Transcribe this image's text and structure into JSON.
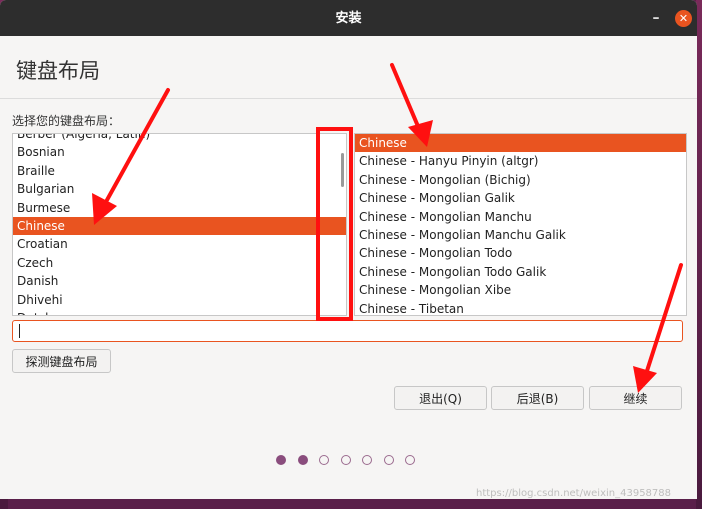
{
  "window": {
    "title": "安装",
    "minimize_glyph": "–",
    "close_glyph": "✕"
  },
  "page": {
    "title": "键盘布局",
    "prompt": "选择您的键盘布局："
  },
  "layouts_left": {
    "items": [
      "Berber (Algeria, Latin)",
      "Bosnian",
      "Braille",
      "Bulgarian",
      "Burmese",
      "Chinese",
      "Croatian",
      "Czech",
      "Danish",
      "Dhivehi",
      "Dutch"
    ],
    "selected": "Chinese"
  },
  "layouts_right": {
    "items": [
      "Chinese",
      "Chinese - Hanyu Pinyin (altgr)",
      "Chinese - Mongolian (Bichig)",
      "Chinese - Mongolian Galik",
      "Chinese - Mongolian Manchu",
      "Chinese - Mongolian Manchu Galik",
      "Chinese - Mongolian Todo",
      "Chinese - Mongolian Todo Galik",
      "Chinese - Mongolian Xibe",
      "Chinese - Tibetan"
    ],
    "selected": "Chinese"
  },
  "test_input": {
    "value": "",
    "placeholder": ""
  },
  "buttons": {
    "detect": "探测键盘布局",
    "quit": "退出(Q)",
    "back": "后退(B)",
    "continue": "继续"
  },
  "progress": {
    "total_steps": 7,
    "current_step": 2
  },
  "watermark": "https://blog.csdn.net/weixin_43958788",
  "colors": {
    "accent": "#e95420",
    "titlebar": "#2d2d2d",
    "annotation": "#ff1010",
    "progress_dot": "#8a4d7d"
  }
}
